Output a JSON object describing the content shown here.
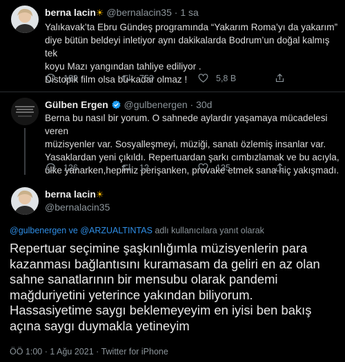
{
  "tweets": [
    {
      "author_name": "berna lacin",
      "author_emoji": "☀",
      "handle": "@bernalacin35",
      "separator": "·",
      "time": "1 sa",
      "lines": [
        "Yalıkavak’ta Ebru Gündeş programında “Yakarım Roma’yı da yakarım”",
        "diye bütün beldeyi inletiyor aynı dakikalarda Bodrum’un doğal kalmış tek",
        "koyu Mazı yangından tahliye ediliyor .",
        "Distopik film olsa bu kadar olmaz !"
      ],
      "stats": {
        "replies": "183",
        "retweets": "753",
        "likes": "5,8 B"
      }
    },
    {
      "author_name": "Gülben Ergen",
      "verified": true,
      "handle": "@gulbenergen",
      "separator": "·",
      "time": "30d",
      "lines": [
        "Berna bu nasıl bir yorum. O sahnede aylardır yaşamaya mücadelesi veren",
        "müzisyenler var. Sosyalleşmeyi, müziği, sanatı özlemiş insanlar var.",
        "Yasaklardan yeni çıkıldı. Repertuardan şarkı cımbızlamak ve bu acıyla,",
        "ülke yanarken,hepimiz perişanken, provake etmek sana hiç yakışmadı."
      ],
      "stats": {
        "replies": "126",
        "retweets": "12",
        "likes": "135"
      }
    }
  ],
  "main_tweet": {
    "author_name": "berna lacin",
    "author_emoji": "☀",
    "handle": "@bernalacin35",
    "replying_mentions": "@gulbenergen ve @ARZUALTINTAS",
    "replying_suffix": "adlı kullanıcılara yanıt olarak",
    "lines": [
      "Repertuar seçimine şaşkınlığımla   müzisyenlerin para",
      "kazanması bağlantısını kuramasam da geliri en az olan",
      "sahne sanatlarının bir mensubu olarak pandemi",
      "mağduriyetini yeterince yakından biliyorum.",
      "Hassasiyetime saygı beklemeyeyim en iyisi ben bakış",
      "açına saygı duymakla yetineyim"
    ],
    "time": "ÖÖ 1:00",
    "date": "1 Ağu 2021",
    "source": "Twitter for iPhone",
    "separator": "·"
  },
  "icons": {
    "reply": "reply-icon",
    "retweet": "retweet-icon",
    "like": "heart-icon",
    "share": "share-icon",
    "verified": "verified-badge-icon",
    "more": "more-icon"
  },
  "colors": {
    "background": "#000000",
    "text": "#dcdcdc",
    "muted": "#8b949a",
    "link": "#2f8ee6",
    "verified": "#1d9bf0",
    "sun": "#f4b400"
  }
}
